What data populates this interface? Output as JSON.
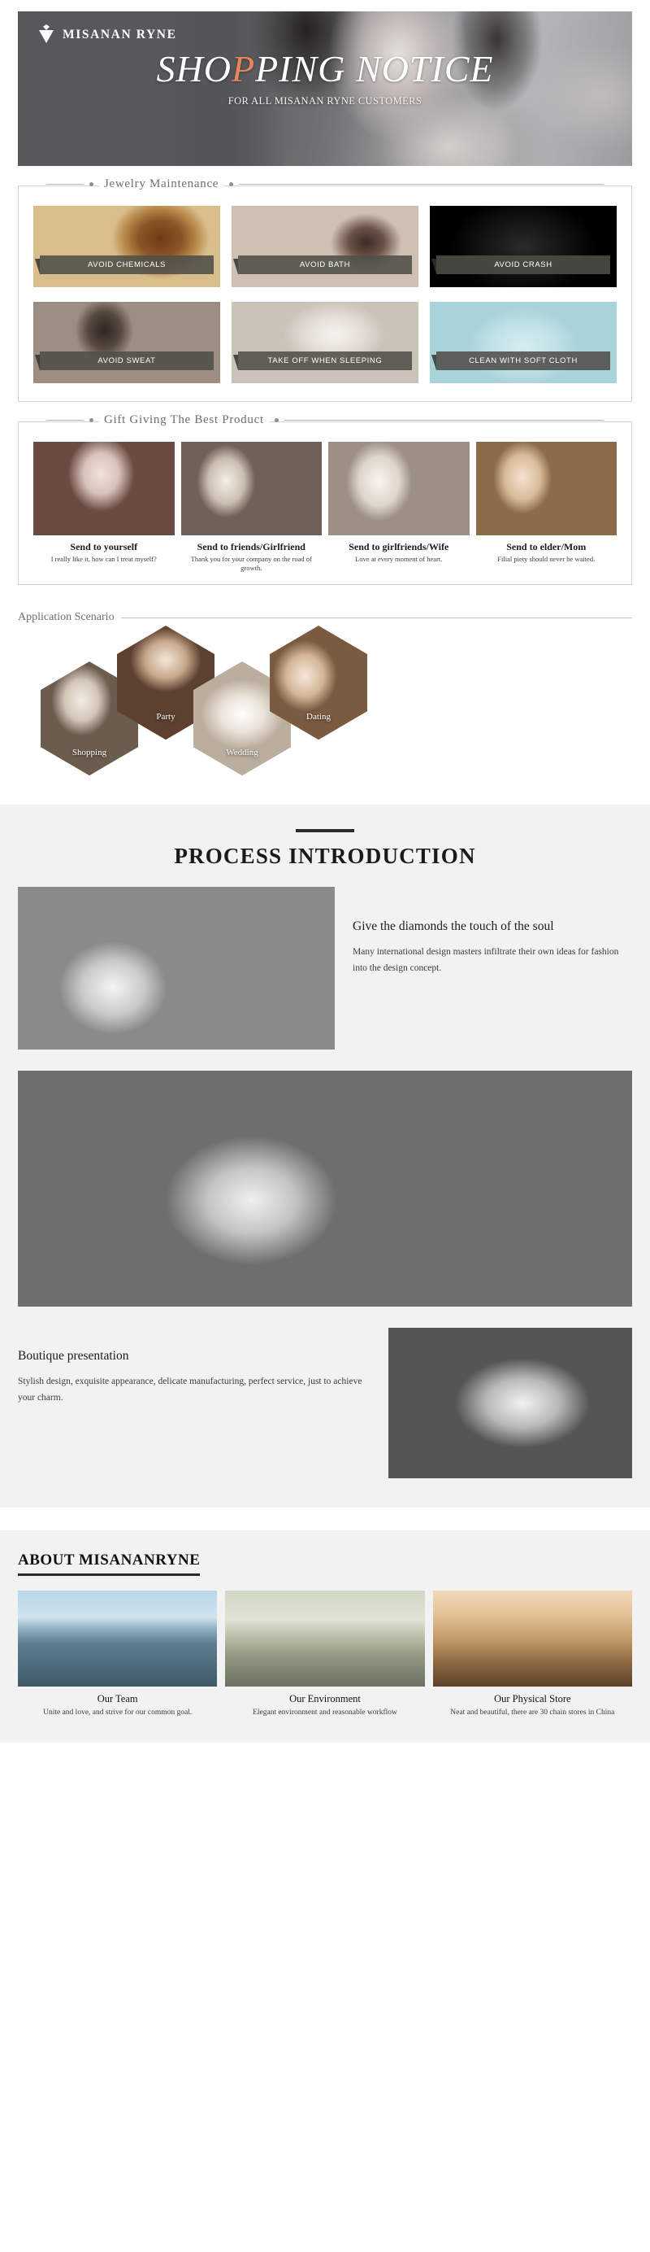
{
  "hero": {
    "brand": "MISANAN RYNE",
    "title_part1": "SHO",
    "title_accent": "P",
    "title_part2": "PING NOTICE",
    "subtitle": "FOR ALL MISANAN RYNE CUSTOMERS"
  },
  "maintenance": {
    "heading": "Jewelry Maintenance",
    "cards": [
      {
        "label": "AVOID CHEMICALS",
        "icon": "chemicals-photo"
      },
      {
        "label": "AVOID BATH",
        "icon": "bath-photo"
      },
      {
        "label": "AVOID CRASH",
        "icon": "crash-photo"
      },
      {
        "label": "AVOID SWEAT",
        "icon": "sweat-photo"
      },
      {
        "label": "TAKE OFF WHEN SLEEPING",
        "icon": "sleeping-photo"
      },
      {
        "label": "CLEAN WITH SOFT CLOTH",
        "icon": "cloth-photo"
      }
    ]
  },
  "gift": {
    "heading": "Gift Giving The Best Product",
    "cards": [
      {
        "title": "Send to yourself",
        "desc": "I really like it, how can I treat myself?"
      },
      {
        "title": "Send to friends/Girlfriend",
        "desc": "Thank you for your company on the road of growth."
      },
      {
        "title": "Send to girlfriends/Wife",
        "desc": "Love at every moment of heart."
      },
      {
        "title": "Send to elder/Mom",
        "desc": "Filial piety should never be waited."
      }
    ]
  },
  "scenario": {
    "heading": "Application Scenario",
    "items": [
      {
        "label": "Shopping"
      },
      {
        "label": "Party"
      },
      {
        "label": "Wedding"
      },
      {
        "label": "Dating"
      }
    ]
  },
  "process": {
    "title": "PROCESS INTRODUCTION",
    "block1_heading": "Give the diamonds the touch of the soul",
    "block1_text": "Many international design masters infiltrate their own ideas for fashion into the design concept.",
    "block3_heading": "Boutique presentation",
    "block3_text": "Stylish design, exquisite appearance, delicate manufacturing, perfect service, just to achieve your charm."
  },
  "about": {
    "title": "ABOUT MISANANRYNE",
    "cards": [
      {
        "title": "Our Team",
        "desc": "Unite and love, and strive for our common goal."
      },
      {
        "title": "Our Environment",
        "desc": "Elegant environment and reasonable workflow"
      },
      {
        "title": "Our Physical Store",
        "desc": "Neat and beautiful, there are 30 chain stores in China"
      }
    ]
  },
  "colors": {
    "accent": "#e8855a",
    "label_bar": "#4e4e48",
    "panel_border": "#d2d2d2",
    "section_bg": "#f2f2f2"
  }
}
